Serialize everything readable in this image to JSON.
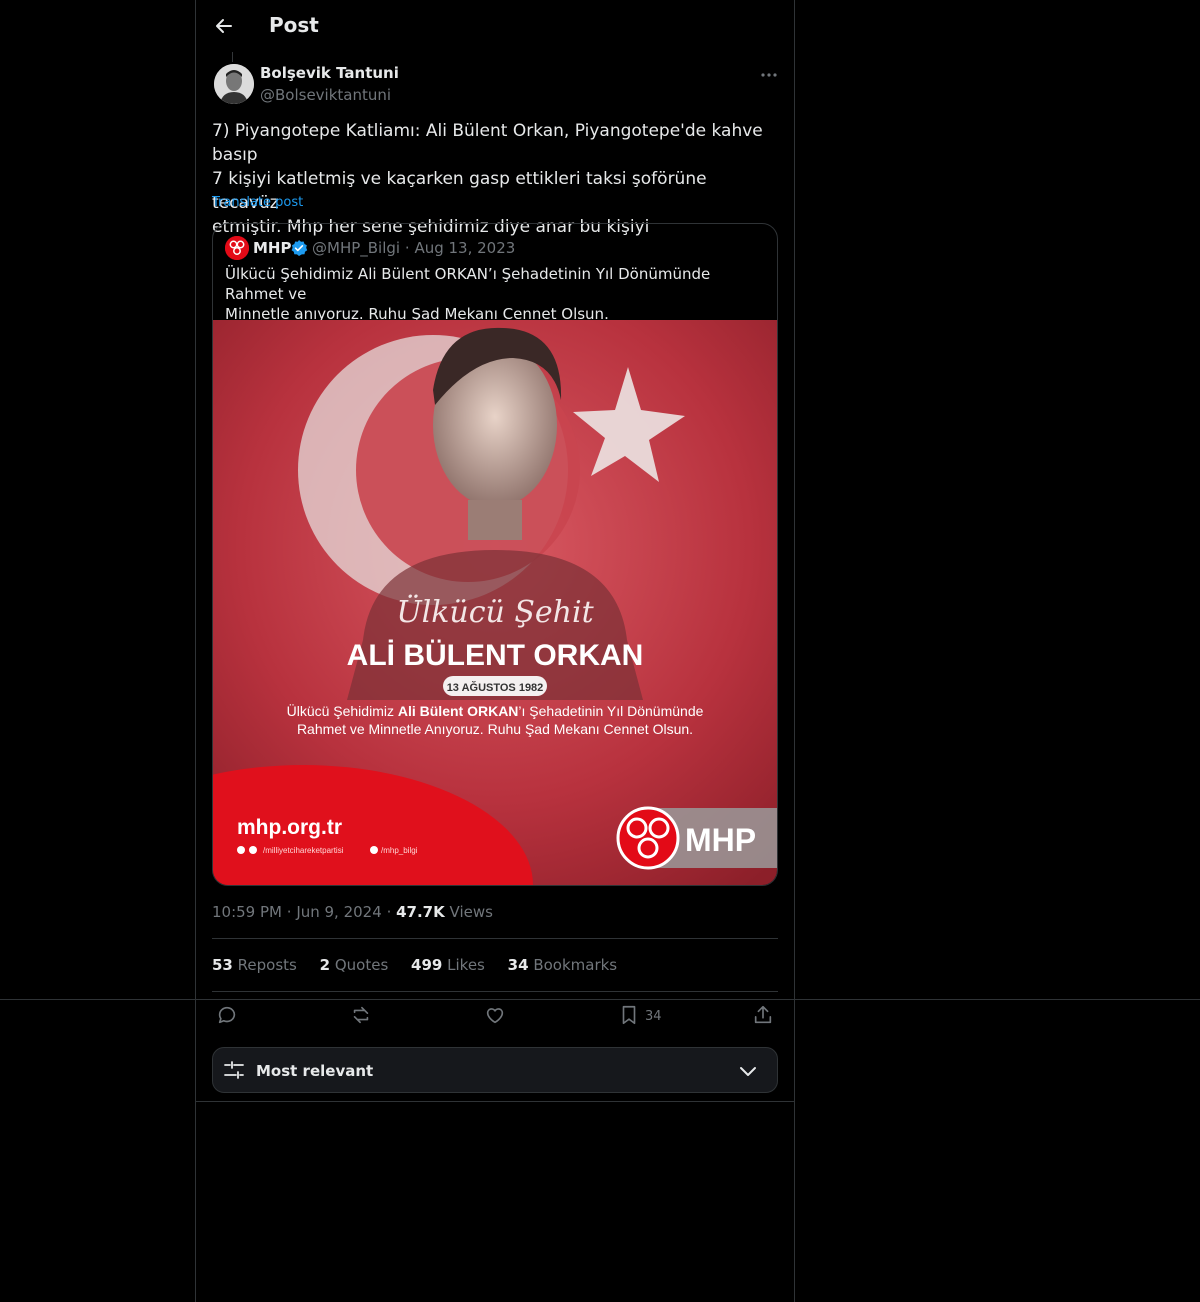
{
  "header": {
    "title": "Post"
  },
  "author": {
    "name": "Bolşevik Tantuni",
    "handle": "@Bolseviktantuni"
  },
  "post": {
    "text": "7) Piyangotepe Katliamı: Ali Bülent Orkan, Piyangotepe'de kahve basıp\n7 kişiyi katletmiş ve kaçarken gasp ettikleri taksi şoförüne tecavüz\netmiştir. Mhp her sene şehidimiz diye anar bu kişiyi",
    "translate_label": "Translate post",
    "time": "10:59 PM",
    "date": "Jun 9, 2024",
    "views_count": "47.7K",
    "views_label": "Views"
  },
  "quote": {
    "name": "MHP",
    "handle": "@MHP_Bilgi",
    "date": "Aug 13, 2023",
    "dot": "·",
    "text": "Ülkücü Şehidimiz Ali Bülent ORKAN’ı Şehadetinin Yıl Dönümünde Rahmet ve\nMinnetle anıyoruz. Ruhu Şad Mekanı Cennet Olsun.",
    "image": {
      "script_title": "Ülkücü Şehit",
      "name_title": "ALİ BÜLENT ORKAN",
      "date_badge": "13 AĞUSTOS 1982",
      "caption_pre": "Ülkücü Şehidimiz ",
      "caption_bold": "Ali Bülent ORKAN",
      "caption_post": "’ı Şehadetinin Yıl Dönümünde",
      "caption_line2": "Rahmet ve Minnetle Anıyoruz. Ruhu Şad Mekanı Cennet Olsun.",
      "website": "mhp.org.tr",
      "social1": "/milliyetcihareketpartisi",
      "social2": "/mhp_bilgi",
      "logo_text": "MHP"
    }
  },
  "stats": {
    "reposts_count": "53",
    "reposts_label": "Reposts",
    "quotes_count": "2",
    "quotes_label": "Quotes",
    "likes_count": "499",
    "likes_label": "Likes",
    "bookmarks_count": "34",
    "bookmarks_label": "Bookmarks"
  },
  "actions": {
    "bookmark_count": "34"
  },
  "sort": {
    "label": "Most relevant"
  },
  "icons": [
    "back-arrow-icon",
    "more-icon",
    "verified-icon",
    "reply-icon",
    "repost-icon",
    "like-icon",
    "bookmark-icon",
    "share-icon",
    "filter-icon",
    "chevron-down-icon"
  ],
  "colors": {
    "accent": "#1d9bf0",
    "background": "#000000",
    "muted": "#71767b",
    "border": "#2f3336",
    "flag_red": "#c81d2b"
  }
}
